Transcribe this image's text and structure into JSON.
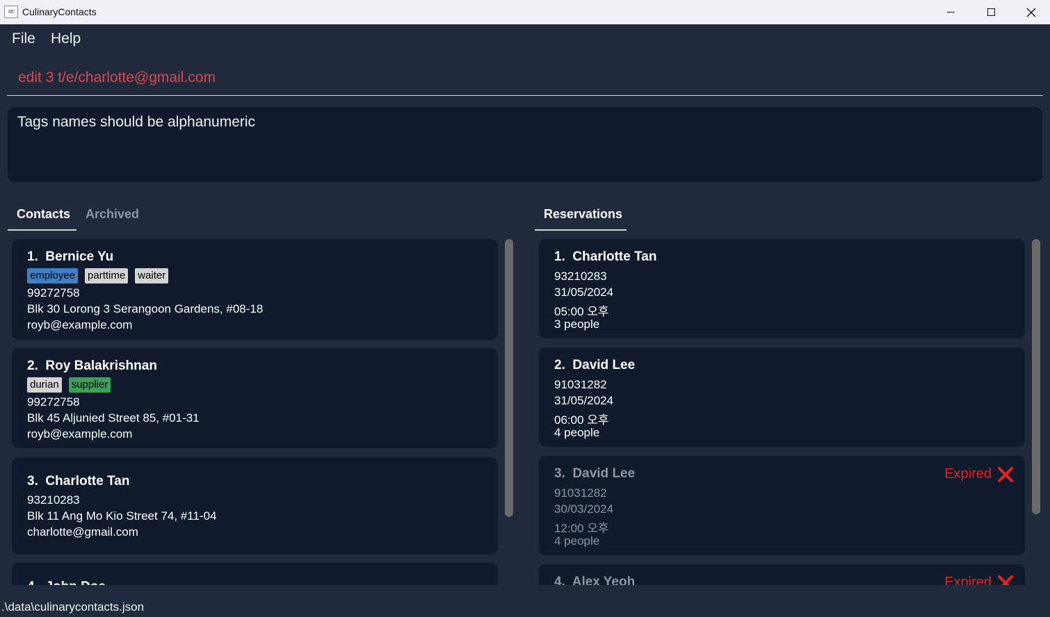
{
  "window": {
    "title": "CulinaryContacts",
    "icon_text": "cc"
  },
  "menu": {
    "file": "File",
    "help": "Help"
  },
  "command": {
    "value": "edit 3 t/e/charlotte@gmail.com"
  },
  "result": {
    "message": "Tags names should be alphanumeric"
  },
  "tabs": {
    "contacts": "Contacts",
    "archived": "Archived",
    "reservations": "Reservations"
  },
  "contacts": [
    {
      "index": "1.",
      "name": "Bernice Yu",
      "tags": [
        "employee",
        "parttime",
        "waiter"
      ],
      "phone": "99272758",
      "address": "Blk 30 Lorong 3 Serangoon Gardens, #08-18",
      "email": "royb@example.com"
    },
    {
      "index": "2.",
      "name": "Roy Balakrishnan",
      "tags": [
        "durian",
        "supplier"
      ],
      "phone": "99272758",
      "address": "Blk 45 Aljunied Street 85, #01-31",
      "email": "royb@example.com"
    },
    {
      "index": "3.",
      "name": "Charlotte Tan",
      "tags": [],
      "phone": "93210283",
      "address": "Blk 11 Ang Mo Kio Street 74, #11-04",
      "email": "charlotte@gmail.com"
    },
    {
      "index": "4.",
      "name": "John Doe"
    }
  ],
  "reservations": [
    {
      "index": "1.",
      "name": "Charlotte Tan",
      "phone": "93210283",
      "date": "31/05/2024",
      "time": "05:00 오후",
      "pax": "3 people"
    },
    {
      "index": "2.",
      "name": "David Lee",
      "phone": "91031282",
      "date": "31/05/2024",
      "time": "06:00 오후",
      "pax": "4 people"
    },
    {
      "index": "3.",
      "name": "David Lee",
      "phone": "91031282",
      "date": "30/03/2024",
      "time": "12:00 오후",
      "pax": "4 people",
      "status": "Expired"
    },
    {
      "index": "4.",
      "name": "Alex Yeoh",
      "status": "Expired"
    }
  ],
  "colors": {
    "tag_blue": "#3d82c8",
    "tag_grey": "#d4d4d4",
    "tag_green": "#3aa05a",
    "expired": "#e82020",
    "command_error": "#e0474c"
  },
  "status_bar": {
    "path": ".\\data\\culinarycontacts.json"
  }
}
